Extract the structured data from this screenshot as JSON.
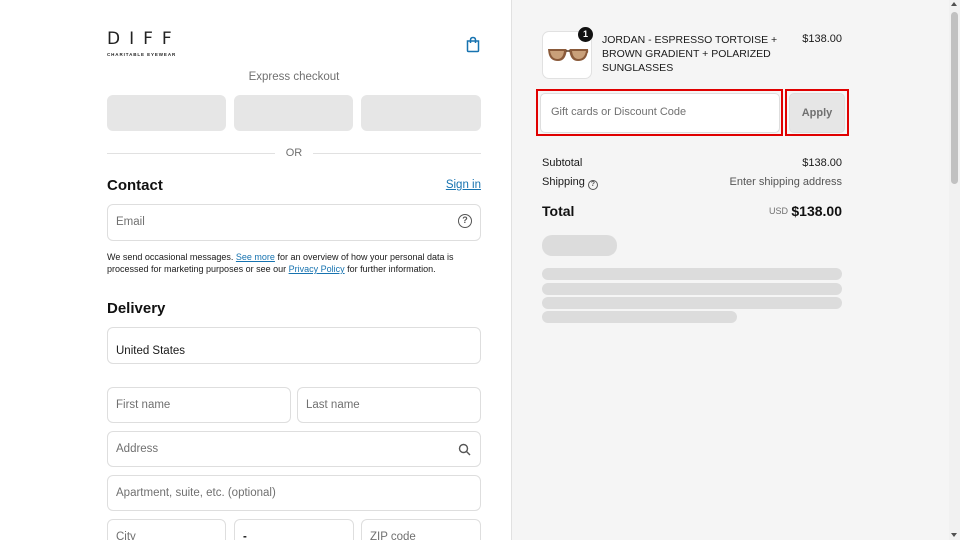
{
  "brand": {
    "name": "DIFF",
    "tagline": "CHARITABLE EYEWEAR"
  },
  "express": {
    "label": "Express checkout",
    "separator": "OR"
  },
  "contact": {
    "heading": "Contact",
    "signin_label": "Sign in",
    "email_placeholder": "Email",
    "notice_prefix": "We send occasional messages. ",
    "see_more": "See more",
    "notice_middle": " for an overview of how your personal data is processed for marketing purposes or see our ",
    "privacy_policy": "Privacy Policy",
    "notice_suffix": " for further information."
  },
  "delivery": {
    "heading": "Delivery",
    "country": "United States",
    "first_name_placeholder": "First name",
    "last_name_placeholder": "Last name",
    "address_placeholder": "Address",
    "apartment_placeholder": "Apartment, suite, etc. (optional)",
    "city_placeholder": "City",
    "state_value": "-",
    "zip_placeholder": "ZIP code"
  },
  "order": {
    "product": {
      "name": "JORDAN - ESPRESSO TORTOISE + BROWN GRADIENT + POLARIZED SUNGLASSES",
      "price": "$138.00",
      "quantity": "1"
    },
    "discount_placeholder": "Gift cards or Discount Code",
    "apply_label": "Apply",
    "subtotal_label": "Subtotal",
    "subtotal_value": "$138.00",
    "shipping_label": "Shipping",
    "shipping_value": "Enter shipping address",
    "total_label": "Total",
    "currency": "USD",
    "total_value": "$138.00"
  },
  "colors": {
    "link": "#1773b0",
    "highlight": "#e00000",
    "panel": "#f5f5f5"
  }
}
